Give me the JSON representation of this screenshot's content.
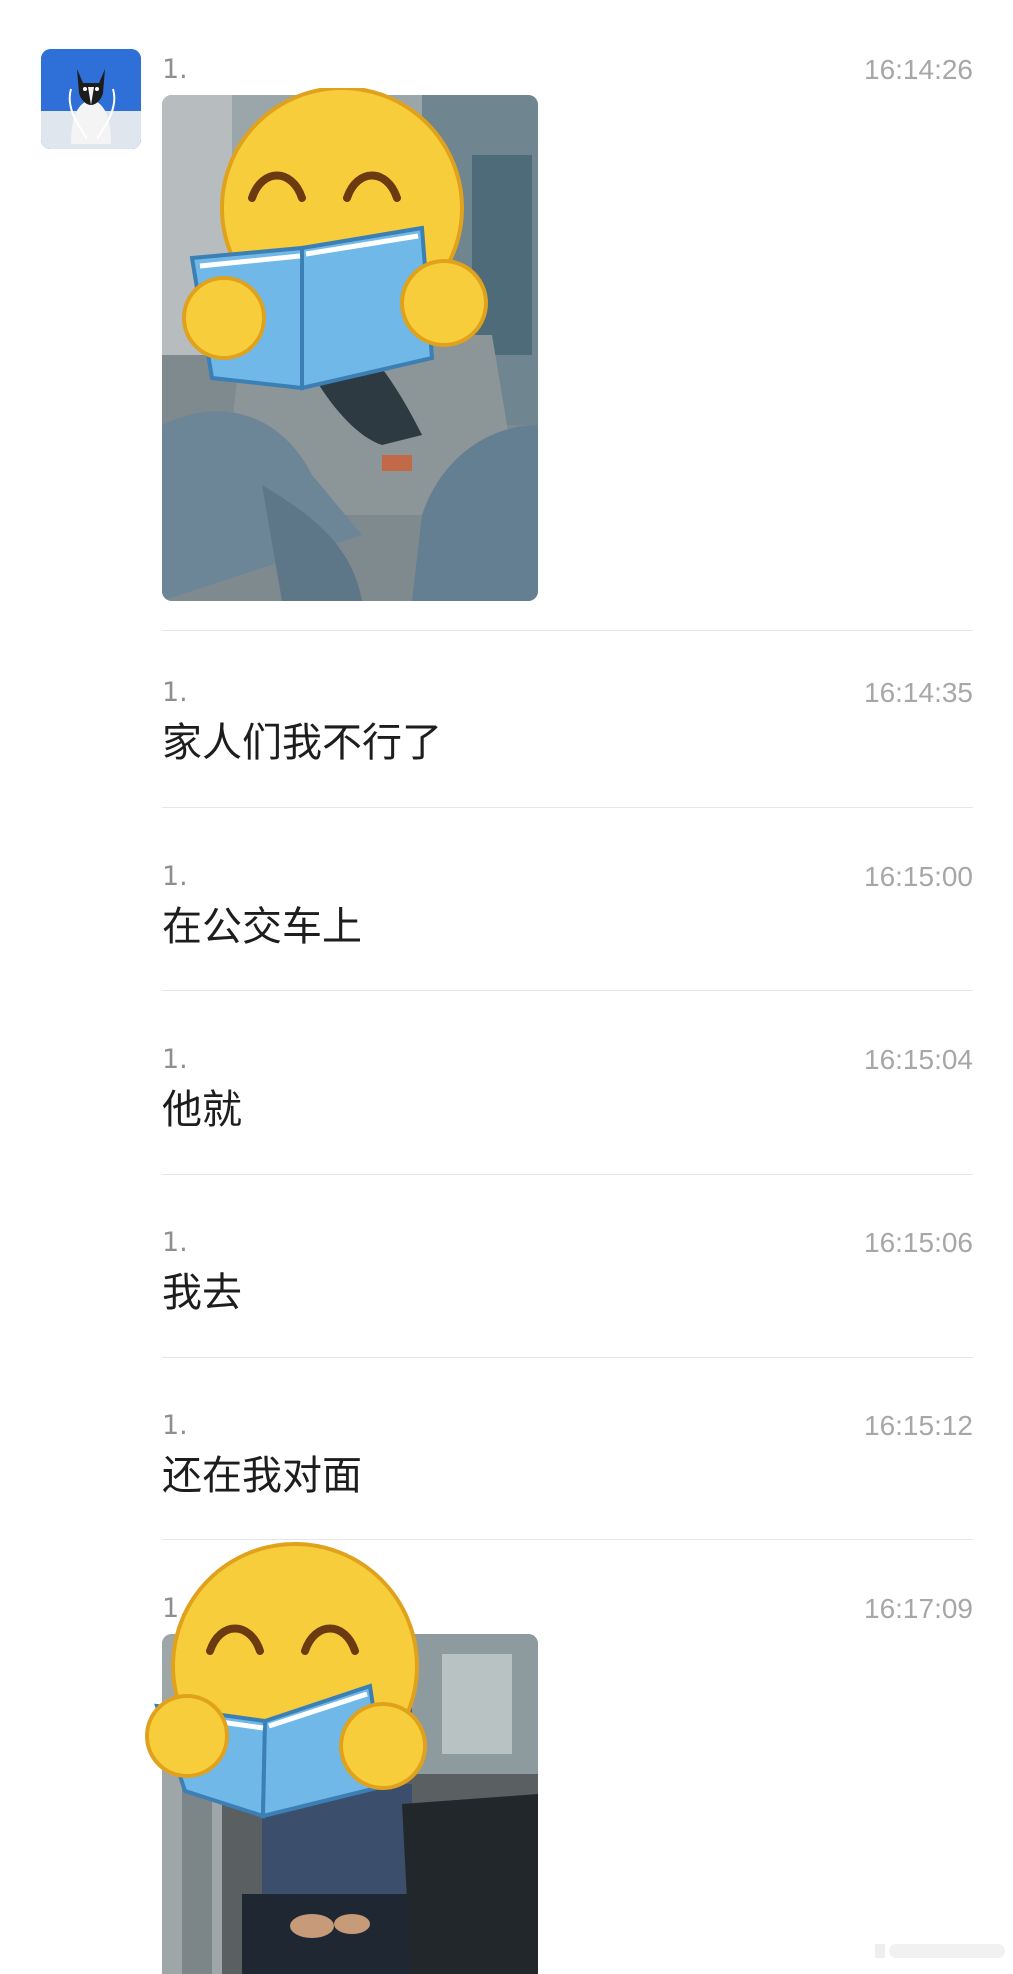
{
  "chat": {
    "messages": [
      {
        "sender": "1.",
        "time": "16:14:26",
        "type": "image",
        "image_desc": "photo inside bus, legs and seats, face covered by reading emoji sticker"
      },
      {
        "sender": "1.",
        "time": "16:14:35",
        "type": "text",
        "text": "家人们我不行了"
      },
      {
        "sender": "1.",
        "time": "16:15:00",
        "type": "text",
        "text": "在公交车上"
      },
      {
        "sender": "1.",
        "time": "16:15:04",
        "type": "text",
        "text": "他就"
      },
      {
        "sender": "1.",
        "time": "16:15:06",
        "type": "text",
        "text": "我去"
      },
      {
        "sender": "1.",
        "time": "16:15:12",
        "type": "text",
        "text": "还在我对面"
      },
      {
        "sender": "1.",
        "time": "16:17:09",
        "type": "image",
        "image_desc": "photo of person seated on bus, face covered by reading emoji sticker"
      }
    ]
  },
  "icons": {
    "avatar": "dog-avatar",
    "sticker": "reading-smiley-emoji"
  },
  "colors": {
    "time": "#a7a7a7",
    "sender": "#8f8f8f",
    "text": "#1d1d1d",
    "divider": "#e6e6e6",
    "emoji_face": "#f7cd3b",
    "book": "#6fb8e8"
  }
}
